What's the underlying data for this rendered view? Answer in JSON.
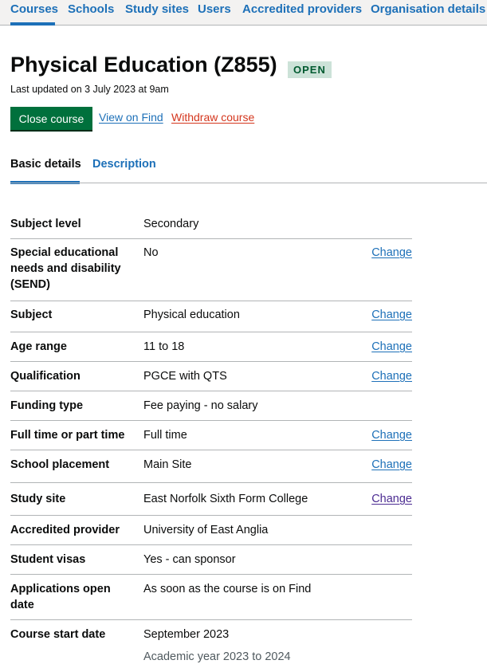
{
  "nav": {
    "items": [
      "Courses",
      "Schools",
      "Study sites",
      "Users",
      "Accredited providers",
      "Organisation details"
    ],
    "active": "Courses"
  },
  "page": {
    "title": "Physical Education (Z855)",
    "status_tag": "OPEN",
    "last_updated": "Last updated on 3 July 2023 at 9am"
  },
  "actions": {
    "close": "Close course",
    "view": "View on Find",
    "withdraw": "Withdraw course"
  },
  "tabs": {
    "basic": "Basic details",
    "description": "Description"
  },
  "summary": {
    "change_label": "Change",
    "rows": [
      {
        "key": "Subject level",
        "value": "Secondary",
        "change": false
      },
      {
        "key": "Special educational needs and disability (SEND)",
        "value": "No",
        "change": true
      },
      {
        "key": "Subject",
        "value": "Physical education",
        "change": true
      },
      {
        "key": "Age range",
        "value": "11 to 18",
        "change": true
      },
      {
        "key": "Qualification",
        "value": "PGCE with QTS",
        "change": true
      },
      {
        "key": "Funding type",
        "value": "Fee paying - no salary",
        "change": false
      },
      {
        "key": "Full time or part time",
        "value": "Full time",
        "change": true
      },
      {
        "key": "School placement",
        "value": "Main Site",
        "change": true
      },
      {
        "key": "Study site",
        "value": "East Norfolk Sixth Form College",
        "change": true
      },
      {
        "key": "Accredited provider",
        "value": "University of East Anglia",
        "change": false
      },
      {
        "key": "Student visas",
        "value": "Yes - can sponsor",
        "change": false
      },
      {
        "key": "Applications open date",
        "value": "As soon as the course is on Find",
        "change": false
      },
      {
        "key": "Course start date",
        "value": "September 2023",
        "hint": "Academic year 2023 to 2024",
        "change": false
      }
    ]
  },
  "colors": {
    "link": "#1d70b8",
    "visited_link": "#4c2c92",
    "button_green": "#00703c",
    "warning_red": "#d4351c",
    "tag_bg": "#cce2d8",
    "tag_text": "#005a30"
  }
}
